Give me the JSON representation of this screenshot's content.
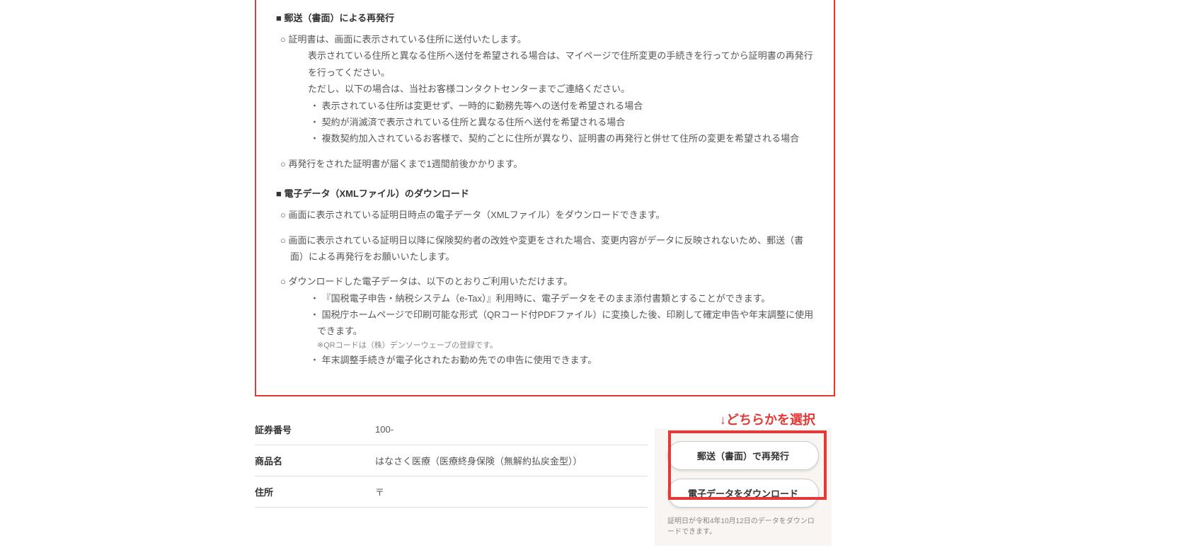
{
  "section1": {
    "title": "■ 郵送（書面）による再発行",
    "items": [
      {
        "main": "○ 証明書は、画面に表示されている住所に送付いたします。",
        "subs": [
          "表示されている住所と異なる住所へ送付を希望される場合は、マイページで住所変更の手続きを行ってから証明書の再発行を行ってください。",
          "ただし、以下の場合は、当社お客様コンタクトセンターまでご連絡ください。"
        ],
        "bullets": [
          "・ 表示されている住所は変更せず、一時的に勤務先等への送付を希望される場合",
          "・ 契約が消滅済で表示されている住所と異なる住所へ送付を希望される場合",
          "・ 複数契約加入されているお客様で、契約ごとに住所が異なり、証明書の再発行と併せて住所の変更を希望される場合"
        ]
      },
      {
        "main": "○ 再発行をされた証明書が届くまで1週間前後かかります。"
      }
    ]
  },
  "section2": {
    "title": "■ 電子データ（XMLファイル）のダウンロード",
    "items": [
      {
        "main": "○ 画面に表示されている証明日時点の電子データ（XMLファイル）をダウンロードできます。"
      },
      {
        "main": "○ 画面に表示されている証明日以降に保険契約者の改姓や変更をされた場合、変更内容がデータに反映されないため、郵送（書面）による再発行をお願いいたします。"
      },
      {
        "main": "○ ダウンロードした電子データは、以下のとおりご利用いただけます。",
        "bullets": [
          "・ 『国税電子申告・納税システム（e-Tax）』利用時に、電子データをそのまま添付書類とすることができます。",
          "・ 国税庁ホームページで印刷可能な形式（QRコード付PDFファイル）に変換した後、印刷して確定申告や年末調整に使用できます。",
          "・ 年末調整手続きが電子化されたお勤め先での申告に使用できます。"
        ],
        "note": "※QRコードは（株）デンソーウェーブの登録です。",
        "noteAfterIndex": 1
      }
    ]
  },
  "table": {
    "rows": [
      {
        "label": "証券番号",
        "value": "100-"
      },
      {
        "label": "商品名",
        "value": "はなさく医療（医療終身保険（無解約払戻金型））"
      },
      {
        "label": "住所",
        "value": "〒"
      }
    ]
  },
  "buttons": {
    "mail": "郵送（書面）で再発行",
    "download": "電子データをダウンロード",
    "note": "証明日が令和4年10月12日のデータをダウンロードできます。"
  },
  "annotation": "↓どちらかを選択"
}
